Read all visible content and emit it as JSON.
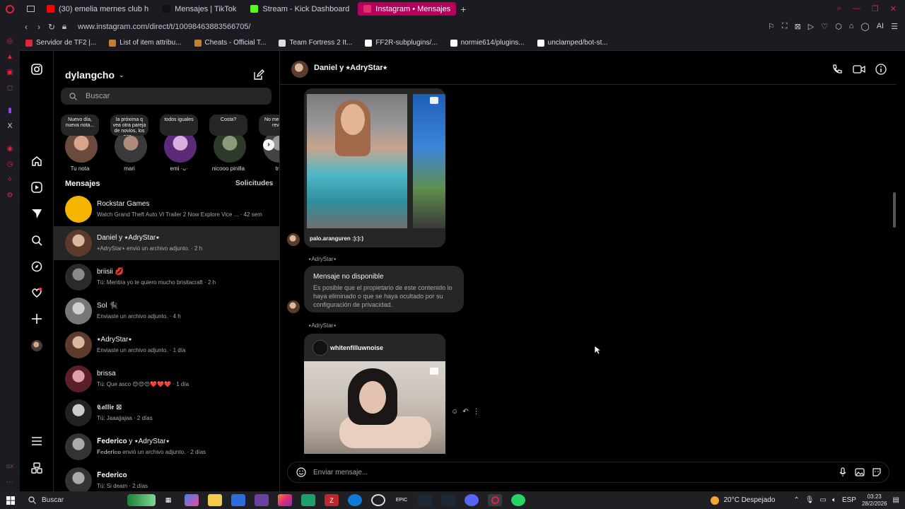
{
  "browser": {
    "tabs": [
      {
        "label": "(30) emelia mernes club h",
        "color": "#ff0000"
      },
      {
        "label": "Mensajes | TikTok",
        "color": "#111111"
      },
      {
        "label": "Stream - Kick Dashboard",
        "color": "#53fc18"
      },
      {
        "label": "Instagram • Mensajes",
        "color": "#e1306c"
      }
    ],
    "url": "www.instagram.com/direct/t/10098463883566705/",
    "bookmarks": [
      {
        "label": "Servidor de TF2 |...",
        "color": "#e0263a"
      },
      {
        "label": "List of item attribu...",
        "color": "#c08030"
      },
      {
        "label": "Cheats - Official T...",
        "color": "#c08030"
      },
      {
        "label": "Team Fortress 2 It...",
        "color": "#dddddd"
      },
      {
        "label": "FF2R-subplugins/...",
        "color": "#ffffff"
      },
      {
        "label": "normie614/plugins...",
        "color": "#ffffff"
      },
      {
        "label": "unclamped/bot-st...",
        "color": "#ffffff"
      }
    ],
    "ai_label": "AI"
  },
  "inbox": {
    "username": "dylangcho",
    "search_placeholder": "Buscar",
    "stories": [
      {
        "note": "Nuevo día, nueva nota...",
        "name": "Tu nota",
        "c1": "#6b4b3e",
        "c2": "#d8a58c"
      },
      {
        "note": "la próxima q vea otra pareja de novios, los pas...",
        "name": "mari",
        "c1": "#3a3a3a",
        "c2": "#b08c7c"
      },
      {
        "note": "todos iguales",
        "name": "emi ·ᴗ·",
        "c1": "#5b2b7a",
        "c2": "#d7b0e0"
      },
      {
        "note": "Costa?",
        "name": "nicooo pinilla",
        "c1": "#2d3a2a",
        "c2": "#8c9a7a"
      },
      {
        "note": "No me q me rever",
        "name": "tri",
        "c1": "#444444",
        "c2": "#9a9a9a"
      }
    ],
    "messages_label": "Mensajes",
    "requests_label": "Solicitudes",
    "conversations": [
      {
        "name": "Rockstar Games",
        "preview": "Watch Grand Theft Auto VI Trailer 2 Now Explore Vice ... · 42 sem",
        "c1": "#f4b400",
        "c2": "#f4b400",
        "active": false
      },
      {
        "name": "Daniel y ⭑AdryStar⭑",
        "preview": "⭑AdryStar⭑ envió un archivo adjunto. · 2 h",
        "c1": "#5a3b2c",
        "c2": "#d9b8a0",
        "active": true
      },
      {
        "name": "briisii 💋",
        "preview": "Tú: Mentira yo te quiero mucho brisitacraft · 2 h",
        "c1": "#2a2a2a",
        "c2": "#8a8a8a",
        "active": false
      },
      {
        "name": "Sol 🐈‍⬛",
        "preview": "Enviaste un archivo adjunto. · 4 h",
        "c1": "#777777",
        "c2": "#cfcfcf",
        "active": false
      },
      {
        "name": "⭑AdryStar⭑",
        "preview": "Enviaste un archivo adjunto. · 1 día",
        "c1": "#5a3b2c",
        "c2": "#d9b8a0",
        "active": false
      },
      {
        "name": "brissa",
        "preview": "Tú: Que asco 😍😍😍❤️❤️❤️ · 1 día",
        "c1": "#5a1f2a",
        "c2": "#e0a0a8",
        "active": false
      },
      {
        "name": "𝕮𝖆𝖑𝖑𝖎𝖊 ⊠",
        "preview": "Tú: Jaaajjajaa · 2 días",
        "c1": "#222222",
        "c2": "#cccccc",
        "active": false
      },
      {
        "name": "𝐅𝐞𝐝𝐞𝐫𝐢𝐜𝐨 y ⭑AdryStar⭑",
        "preview": "𝐅𝐞𝐝𝐞𝐫𝐢𝐜𝐨 envió un archivo adjunto. · 2 días",
        "c1": "#333333",
        "c2": "#aaaaaa",
        "active": false
      },
      {
        "name": "𝐅𝐞𝐝𝐞𝐫𝐢𝐜𝐨",
        "preview": "Tú: Si deam · 2 días",
        "c1": "#333333",
        "c2": "#aaaaaa",
        "active": false
      }
    ]
  },
  "chat": {
    "title": "Daniel y ⭑AdryStar⭑",
    "post1_caption": "palo.aranguren :):):)",
    "sender1": "⭑AdryStar⭑",
    "unavailable_title": "Mensaje no disponible",
    "unavailable_desc": "Es posible que el propietario de este contenido lo haya eliminado o que se haya ocultado por su configuración de privacidad.",
    "sender2": "⭑AdryStar⭑",
    "post2_user": "whitenfilluwnoise",
    "composer_placeholder": "Enviar mensaje..."
  },
  "taskbar": {
    "search": "Buscar",
    "weather": "20°C Despejado",
    "lang": "ESP",
    "time": "03:23",
    "date": "28/2/2026"
  }
}
